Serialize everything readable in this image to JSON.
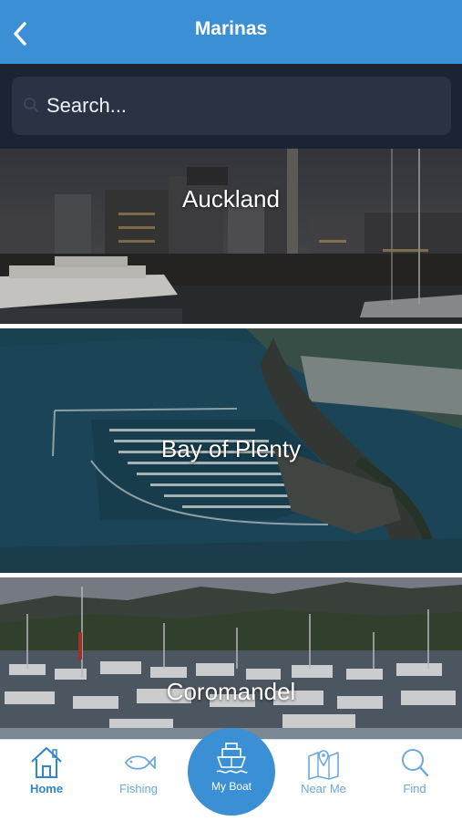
{
  "header": {
    "title": "Marinas",
    "back_icon": "chevron-left-icon"
  },
  "search": {
    "placeholder": "Search...",
    "value": ""
  },
  "marinas": [
    {
      "name": "Auckland"
    },
    {
      "name": "Bay of Plenty"
    },
    {
      "name": "Coromandel"
    }
  ],
  "tabs": [
    {
      "label": "Home",
      "icon": "home-icon",
      "active": true
    },
    {
      "label": "Fishing",
      "icon": "fish-icon",
      "active": false
    },
    {
      "label": "My Boat",
      "icon": "boat-icon",
      "active": false
    },
    {
      "label": "Near Me",
      "icon": "map-pin-icon",
      "active": false
    },
    {
      "label": "Find",
      "icon": "search-icon",
      "active": false
    }
  ],
  "colors": {
    "accent": "#3b8fd4",
    "search_band": "#1b2433",
    "search_field": "#2a3344"
  }
}
